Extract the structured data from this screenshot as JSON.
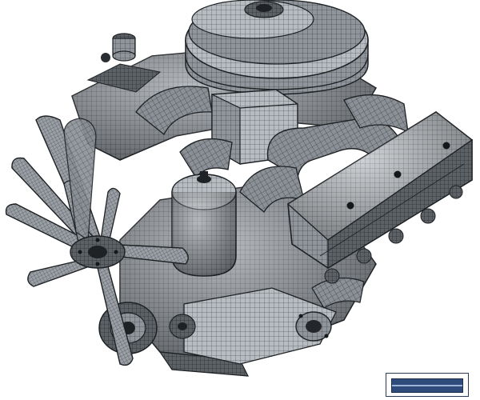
{
  "image": {
    "subject": "v8-engine-wireframe-render",
    "colors": {
      "background": "#ffffff",
      "mesh_fill": "#8a9096",
      "mesh_fill_light": "#b4babf",
      "mesh_fill_dark": "#55595e",
      "wire": "#1e2124",
      "badge_blue": "#2f4b7c"
    }
  }
}
